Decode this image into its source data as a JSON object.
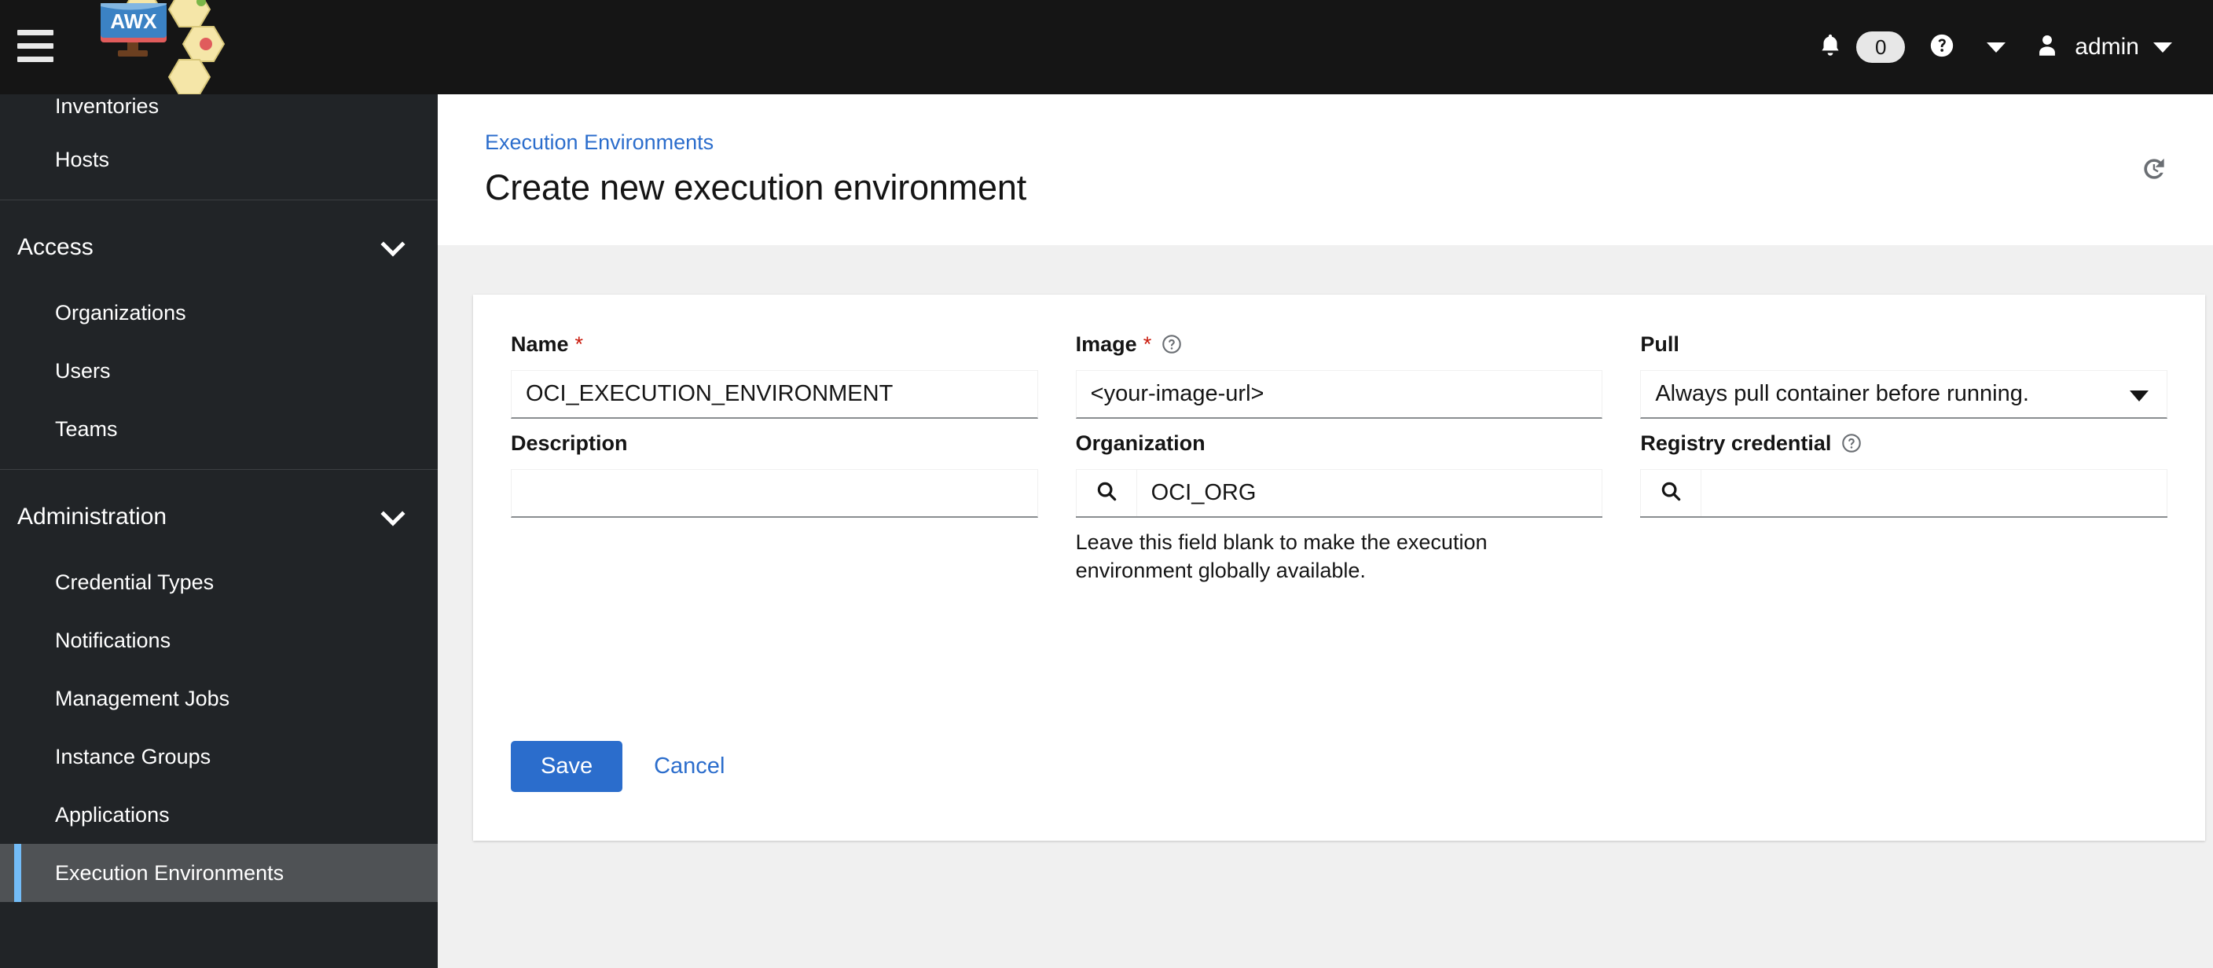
{
  "masthead": {
    "menu_toggle_label": "Toggle navigation",
    "brand_text": "AWX",
    "notifications_icon": "bell-icon",
    "notifications_count": "0",
    "help_icon": "question-circle-icon",
    "help_caret_icon": "caret-down-icon",
    "user_icon": "user-avatar-icon",
    "username": "admin",
    "user_caret_icon": "caret-down-icon"
  },
  "sidebar": {
    "groups": [
      {
        "type": "items",
        "items": [
          {
            "label": "Inventories",
            "active": false,
            "clipped": true
          },
          {
            "label": "Hosts",
            "active": false
          }
        ]
      },
      {
        "type": "group",
        "title": "Access",
        "expand_icon": "chevron-down-icon",
        "items": [
          {
            "label": "Organizations",
            "active": false
          },
          {
            "label": "Users",
            "active": false
          },
          {
            "label": "Teams",
            "active": false
          }
        ]
      },
      {
        "type": "group",
        "title": "Administration",
        "expand_icon": "chevron-down-icon",
        "items": [
          {
            "label": "Credential Types",
            "active": false
          },
          {
            "label": "Notifications",
            "active": false
          },
          {
            "label": "Management Jobs",
            "active": false
          },
          {
            "label": "Instance Groups",
            "active": false
          },
          {
            "label": "Applications",
            "active": false
          },
          {
            "label": "Execution Environments",
            "active": true
          }
        ]
      }
    ],
    "active_item": "Execution Environments",
    "active_accent_color": "#73bcf7"
  },
  "page": {
    "breadcrumb": "Execution Environments",
    "title": "Create new execution environment",
    "history_icon": "history-icon"
  },
  "form": {
    "name": {
      "label": "Name",
      "required_marker": "*",
      "value": "OCI_EXECUTION_ENVIRONMENT"
    },
    "image": {
      "label": "Image",
      "required_marker": "*",
      "help_icon": "question-circle-icon",
      "value": "<your-image-url>"
    },
    "pull": {
      "label": "Pull",
      "value": "Always pull container before running.",
      "caret_icon": "caret-down-icon"
    },
    "description": {
      "label": "Description",
      "value": ""
    },
    "organization": {
      "label": "Organization",
      "search_icon": "search-icon",
      "value": "OCI_ORG",
      "helper_text": "Leave this field blank to make the execution environment globally available."
    },
    "registry_credential": {
      "label": "Registry credential",
      "help_icon": "question-circle-icon",
      "search_icon": "search-icon",
      "value": ""
    },
    "save_label": "Save",
    "cancel_label": "Cancel"
  },
  "colors": {
    "masthead_bg": "#151515",
    "sidebar_bg": "#212427",
    "accent_blue": "#2b6dcc",
    "required_red": "#c9190b",
    "page_bg": "#f0f0f0"
  }
}
